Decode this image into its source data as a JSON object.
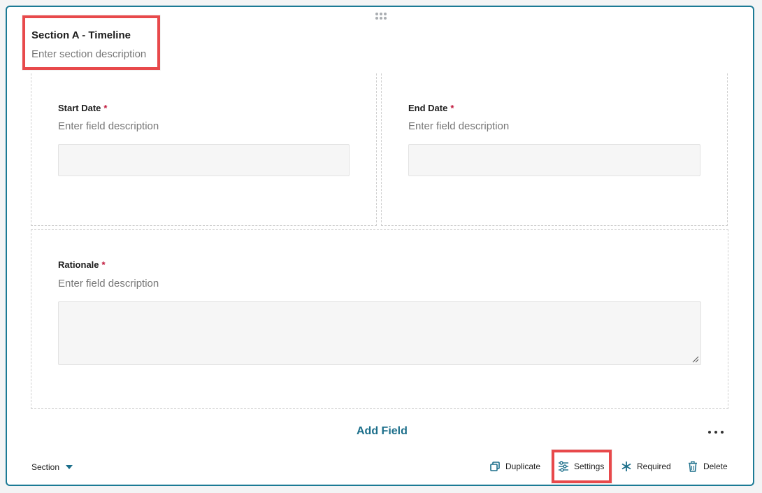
{
  "section": {
    "title": "Section A - Timeline",
    "description": "Enter section description"
  },
  "fields": {
    "start_date": {
      "label": "Start Date",
      "required_mark": "*",
      "description": "Enter field description"
    },
    "end_date": {
      "label": "End Date",
      "required_mark": "*",
      "description": "Enter field description"
    },
    "rationale": {
      "label": "Rationale",
      "required_mark": "*",
      "description": "Enter field description"
    }
  },
  "add_field_label": "Add Field",
  "footer": {
    "type_label": "Section",
    "actions": {
      "duplicate": "Duplicate",
      "settings": "Settings",
      "required": "Required",
      "delete": "Delete"
    }
  },
  "icons": {
    "drag": "drag-handle-icon",
    "more": "more-horizontal-icon",
    "caret": "chevron-down-icon",
    "duplicate": "duplicate-icon",
    "settings": "settings-sliders-icon",
    "required": "asterisk-icon",
    "delete": "trash-icon"
  },
  "colors": {
    "accent": "#1b6e8a",
    "border": "#1b7a95",
    "required": "#c0173b",
    "highlight": "#e8494b"
  }
}
